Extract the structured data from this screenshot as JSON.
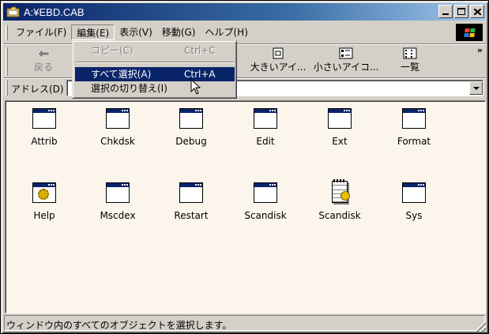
{
  "window": {
    "title": "A:¥EBD.CAB",
    "icon": "folder-icon"
  },
  "title_buttons": [
    "minimize",
    "maximize",
    "close"
  ],
  "menubar": {
    "items": [
      {
        "label": "ファイル(F)"
      },
      {
        "label": "編集(E)"
      },
      {
        "label": "表示(V)"
      },
      {
        "label": "移動(G)"
      },
      {
        "label": "ヘルプ(H)"
      }
    ]
  },
  "toolbar": {
    "back": {
      "label": "戻る",
      "icon": "back-arrow-icon"
    },
    "large_icons": {
      "label": "大きいアイ...",
      "icon": "large-icons-view-icon"
    },
    "small_icons": {
      "label": "小さいアイコ...",
      "icon": "small-icons-view-icon"
    },
    "list": {
      "label": "一覧",
      "icon": "list-view-icon"
    },
    "more": "»"
  },
  "address": {
    "label": "アドレス(D)",
    "value": ""
  },
  "edit_menu": {
    "items": [
      {
        "label": "コピー(C)",
        "shortcut": "Ctrl+C",
        "state": "disabled"
      },
      {
        "label": "すべて選択(A)",
        "shortcut": "Ctrl+A",
        "state": "highlighted"
      },
      {
        "label": "選択の切り替え(I)",
        "shortcut": "",
        "state": "normal"
      }
    ]
  },
  "files": [
    {
      "name": "Attrib",
      "icon": "application-window-icon"
    },
    {
      "name": "Chkdsk",
      "icon": "application-window-icon"
    },
    {
      "name": "Debug",
      "icon": "application-window-icon"
    },
    {
      "name": "Edit",
      "icon": "application-window-icon"
    },
    {
      "name": "Ext",
      "icon": "application-window-icon"
    },
    {
      "name": "Format",
      "icon": "application-window-icon"
    },
    {
      "name": "Help",
      "icon": "help-gear-icon"
    },
    {
      "name": "Mscdex",
      "icon": "application-window-icon"
    },
    {
      "name": "Restart",
      "icon": "application-window-icon"
    },
    {
      "name": "Scandisk",
      "icon": "application-window-icon"
    },
    {
      "name": "Scandisk",
      "icon": "config-notepad-icon"
    },
    {
      "name": "Sys",
      "icon": "application-window-icon"
    }
  ],
  "status": {
    "text": "ウィンドウ内のすべてのオブジェクトを選択します。"
  },
  "colors": {
    "title_bar": "#0a246a",
    "selection": "#0a246a",
    "content_bg": "#fbf5ec",
    "face": "#d4d0c8"
  }
}
